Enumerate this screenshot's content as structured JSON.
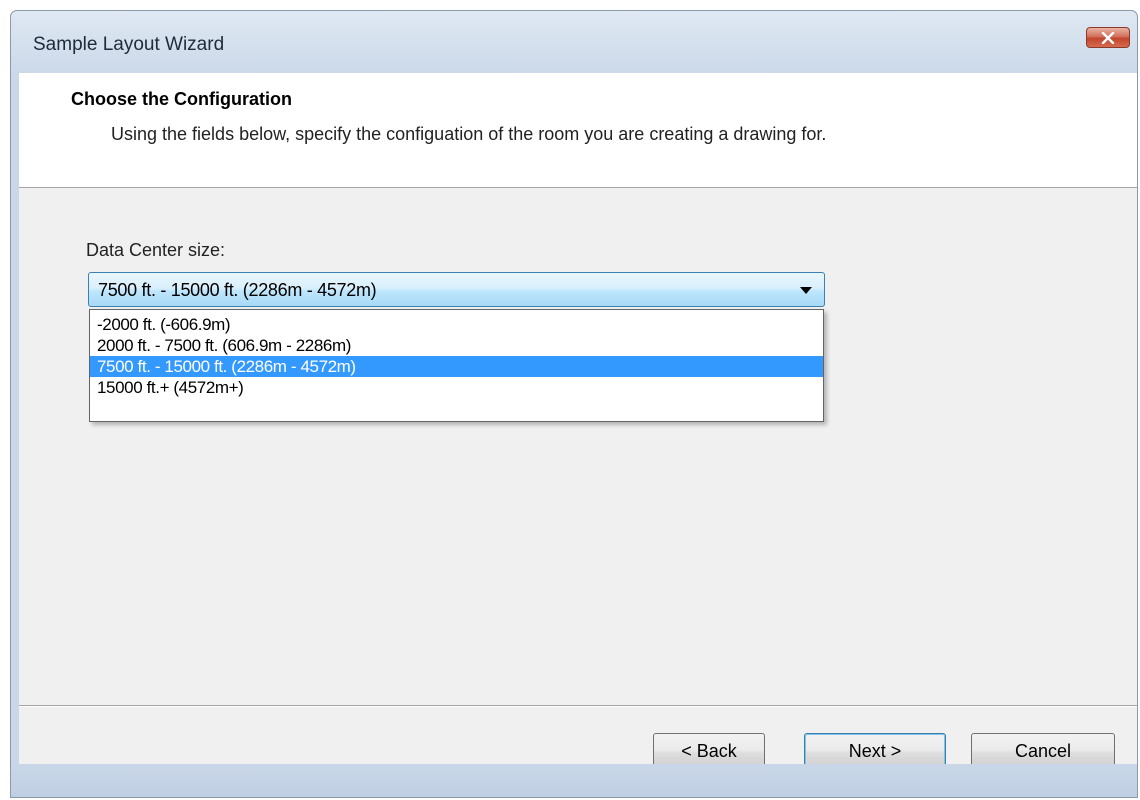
{
  "window": {
    "title": "Sample Layout Wizard"
  },
  "header": {
    "title": "Choose the Configuration",
    "description": "Using the fields below, specify the configuation of the room you are creating a drawing for."
  },
  "form": {
    "field_label": "Data Center size:",
    "selected_value": "7500 ft. - 15000 ft. (2286m - 4572m)",
    "options": [
      "-2000 ft. (-606.9m)",
      "2000 ft. - 7500 ft. (606.9m - 2286m)",
      "7500 ft. - 15000 ft. (2286m - 4572m)",
      "15000 ft.+ (4572m+)"
    ]
  },
  "buttons": {
    "back": "< Back",
    "next": "Next >",
    "cancel": "Cancel"
  },
  "colors": {
    "selection_highlight": "#3399ff",
    "close_button": "#c2452d"
  },
  "icons": {
    "close": "close-icon",
    "dropdown": "chevron-down-icon"
  }
}
